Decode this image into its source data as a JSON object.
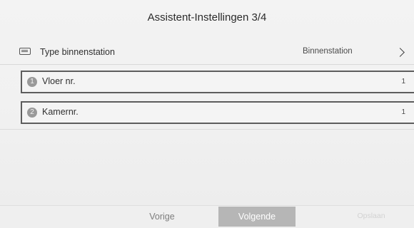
{
  "header": {
    "title": "Assistent-Instellingen 3/4"
  },
  "settings": {
    "type_row": {
      "label": "Type binnenstation",
      "value": "Binnenstation",
      "icon": "keyboard-icon",
      "chevron": "chevron-right-icon"
    },
    "fields": [
      {
        "number": "1",
        "label": "Vloer nr.",
        "value": "1"
      },
      {
        "number": "2",
        "label": "Kamernr.",
        "value": "1"
      }
    ]
  },
  "footer": {
    "prev_label": "Vorige",
    "next_label": "Volgende",
    "save_label": "Opslaan"
  },
  "colors": {
    "background": "#f1f1f1",
    "field_border": "#5d5d5d",
    "badge": "#999999",
    "active_button": "#b6b6b6"
  }
}
